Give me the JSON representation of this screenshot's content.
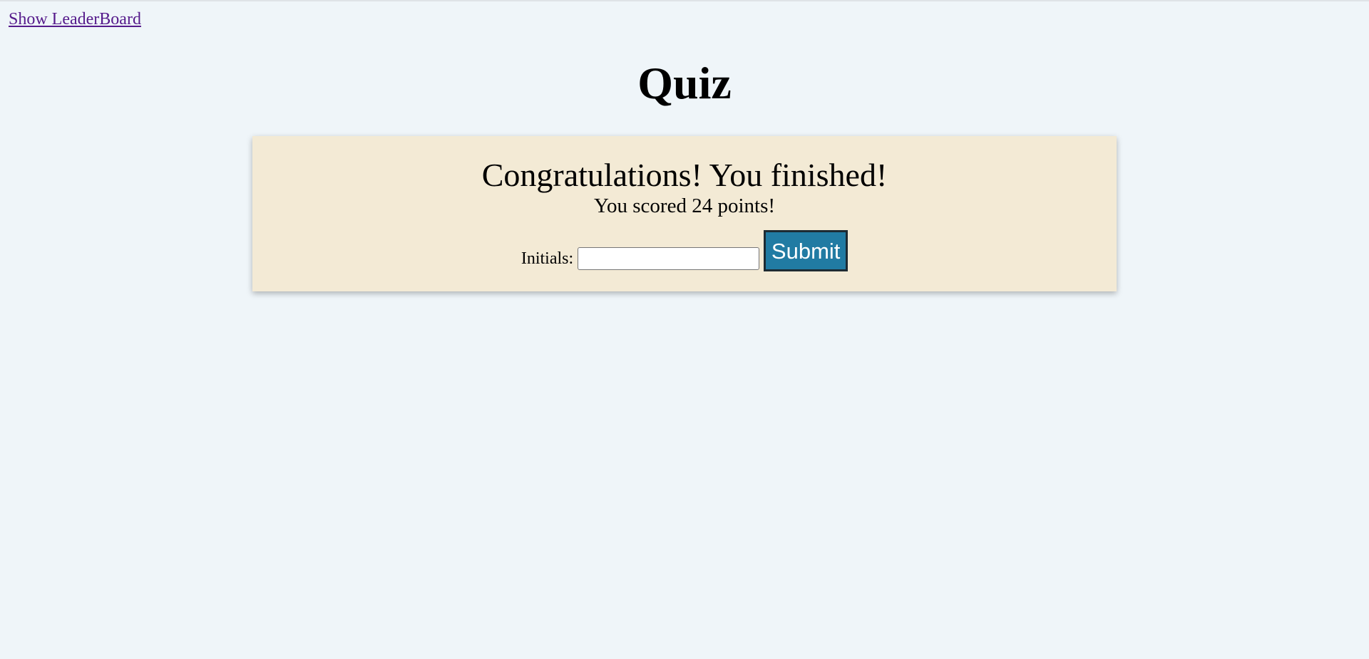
{
  "nav": {
    "leaderboard_link": "Show LeaderBoard"
  },
  "header": {
    "title": "Quiz"
  },
  "result_card": {
    "congrats": "Congratulations! You finished!",
    "score_prefix": "You scored ",
    "score_value": "24",
    "score_suffix": " points!",
    "initials_label": "Initials:",
    "initials_value": "",
    "initials_placeholder": "",
    "submit_label": "Submit"
  },
  "colors": {
    "page_background": "#eff5f9",
    "card_background": "#f3ead5",
    "submit_background": "#217ba3",
    "link_visited": "#551a8b"
  }
}
